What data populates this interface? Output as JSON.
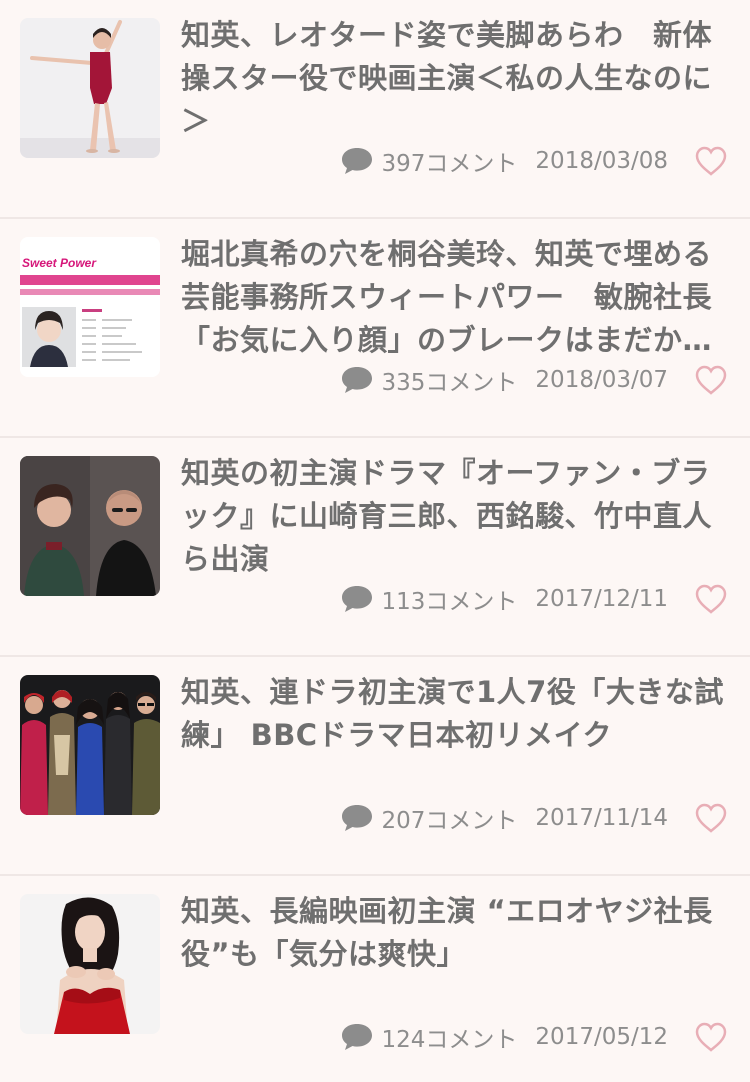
{
  "colors": {
    "background": "#fdf7f5",
    "title": "#6f6f6f",
    "meta": "#8d8d8d",
    "heart": "#e8aeb6",
    "divider": "#efe7e5"
  },
  "articles": [
    {
      "title": "知英、レオタード姿で美脚あらわ　新体操スター役で映画主演＜私の人生なのに＞",
      "comments": "397コメント",
      "date": "2018/03/08",
      "thumb_icon": "leotard-photo",
      "comment_icon": "comment-bubble-icon",
      "fav_icon": "heart-outline-icon"
    },
    {
      "title": "堀北真希の穴を桐谷美玲、知英で埋める芸能事務所スウィートパワー　敏腕社長「お気に入り顔」のブレークはまだか…",
      "comments": "335コメント",
      "date": "2018/03/07",
      "thumb_icon": "agency-website-photo",
      "thumb_logo_text": "Sweet Power",
      "comment_icon": "comment-bubble-icon",
      "fav_icon": "heart-outline-icon"
    },
    {
      "title": "知英の初主演ドラマ『オーファン・ブラック』に山崎育三郎、西銘駿、竹中直人ら出演",
      "comments": "113コメント",
      "date": "2017/12/11",
      "thumb_icon": "two-actors-photo",
      "comment_icon": "comment-bubble-icon",
      "fav_icon": "heart-outline-icon"
    },
    {
      "title": "知英、連ドラ初主演で1人7役「大きな試練」 BBCドラマ日本初リメイク",
      "comments": "207コメント",
      "date": "2017/11/14",
      "thumb_icon": "group-cast-photo",
      "comment_icon": "comment-bubble-icon",
      "fav_icon": "heart-outline-icon"
    },
    {
      "title": "知英、長編映画初主演 “エロオヤジ社長役”も「気分は爽快」",
      "comments": "124コメント",
      "date": "2017/05/12",
      "thumb_icon": "red-dress-photo",
      "comment_icon": "comment-bubble-icon",
      "fav_icon": "heart-outline-icon"
    }
  ]
}
